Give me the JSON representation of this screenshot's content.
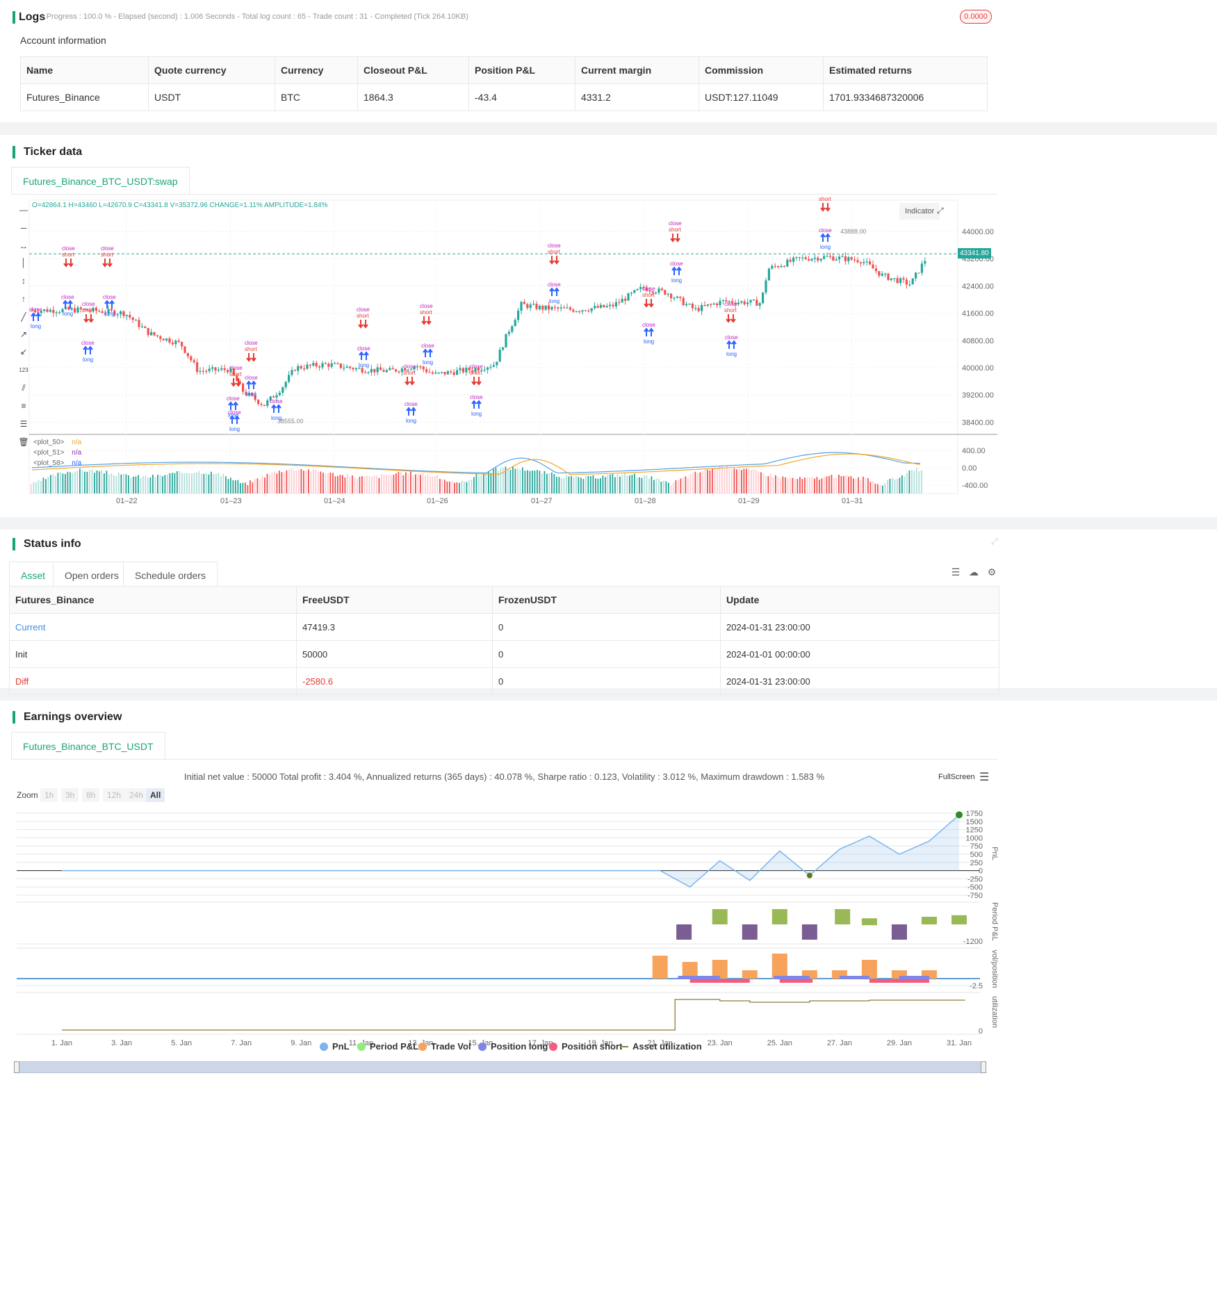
{
  "logs": {
    "title": "Logs",
    "status": "- Progress : 100.0 % - Elapsed (second) : 1.006 Seconds - Total log count : 65 - Trade count : 31 - Completed (Tick 264.10KB)",
    "badge": "0.0000"
  },
  "account": {
    "title": "Account information",
    "headers": [
      "Name",
      "Quote currency",
      "Currency",
      "Closeout P&L",
      "Position P&L",
      "Current margin",
      "Commission",
      "Estimated returns"
    ],
    "row": [
      "Futures_Binance",
      "USDT",
      "BTC",
      "1864.3",
      "-43.4",
      "4331.2",
      "USDT:127.11049",
      "1701.9334687320006"
    ]
  },
  "ticker": {
    "title": "Ticker data",
    "tab": "Futures_Binance_BTC_USDT:swap",
    "ohlc": "O=42864.1 H=43460 L=42670.9 C=43341.8 V=35372.96 CHANGE=1.11% AMPLITUDE=1.84%",
    "indicator_btn": "Indicator",
    "price_tag": "43341.80",
    "high_label": "43888.00",
    "low_label": "38555.00",
    "price_ticks": [
      "44000.00",
      "43200.00",
      "42400.00",
      "41600.00",
      "40800.00",
      "40000.00",
      "39200.00",
      "38400.00"
    ],
    "osc_ticks": [
      "400.00",
      "0.00",
      "-400.00"
    ],
    "date_ticks": [
      "01–22",
      "01–23",
      "01–24",
      "01–26",
      "01–27",
      "01–28",
      "01–29",
      "01–31"
    ],
    "plots": [
      {
        "name": "<plot_50>",
        "value": "n/a",
        "color": "#f5a623"
      },
      {
        "name": "<plot_51>",
        "value": "n/a",
        "color": "#9c27b0"
      },
      {
        "name": "<plot_58>",
        "value": "n/a",
        "color": "#2962ff"
      }
    ]
  },
  "status": {
    "title": "Status info",
    "tabs": [
      "Asset",
      "Open orders",
      "Schedule orders"
    ],
    "headers": [
      "Futures_Binance",
      "FreeUSDT",
      "FrozenUSDT",
      "Update"
    ],
    "rows": [
      [
        "Current",
        "47419.3",
        "0",
        "2024-01-31 23:00:00"
      ],
      [
        "Init",
        "50000",
        "0",
        "2024-01-01 00:00:00"
      ],
      [
        "Diff",
        "-2580.6",
        "0",
        "2024-01-31 23:00:00"
      ]
    ]
  },
  "earnings": {
    "title": "Earnings overview",
    "tab": "Futures_Binance_BTC_USDT",
    "summary": "Initial net value : 50000 Total profit : 3.404 %, Annualized returns (365 days) : 40.078 %, Sharpe ratio : 0.123, Volatility : 3.012 %, Maximum drawdown : 1.583 %",
    "fullscreen": "FullScreen",
    "zoom_label": "Zoom",
    "zoom_buttons": [
      "1h",
      "3h",
      "8h",
      "12h",
      "24h",
      "All"
    ],
    "pnl_ticks": [
      "1750",
      "1500",
      "1250",
      "1000",
      "750",
      "500",
      "250",
      "0",
      "-250",
      "-500",
      "-750"
    ],
    "period_tick": "-1200",
    "vol_tick": "-2.5",
    "util_tick": "0",
    "axis_labels": [
      "PnL",
      "Period P&L",
      "vol/position",
      "utilization"
    ],
    "date_ticks": [
      "1. Jan",
      "3. Jan",
      "5. Jan",
      "7. Jan",
      "9. Jan",
      "11. Jan",
      "13. Jan",
      "15. Jan",
      "17. Jan",
      "19. Jan",
      "21. Jan",
      "23. Jan",
      "25. Jan",
      "27. Jan",
      "29. Jan",
      "31. Jan"
    ],
    "legend": [
      {
        "label": "PnL",
        "color": "#7cb5ec"
      },
      {
        "label": "Period P&L",
        "color": "#90ed7d"
      },
      {
        "label": "Trade Vol",
        "color": "#f7a35c"
      },
      {
        "label": "Position long",
        "color": "#8085e9"
      },
      {
        "label": "Position short",
        "color": "#f15c80"
      },
      {
        "label": "Asset utilization",
        "color": "#8d7a3c"
      }
    ]
  },
  "colors": {
    "accent": "#1aa37a",
    "up": "#26a69a",
    "down": "#ef5350",
    "negative": "#e53935"
  }
}
